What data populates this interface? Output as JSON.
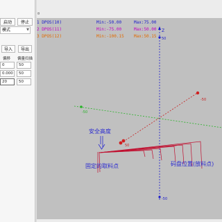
{
  "toolbar": {
    "button_1": "启动",
    "button_2": "停止",
    "mode_value": "模式",
    "import_label": "导入",
    "export_label": "导出",
    "tab_marker": "¤"
  },
  "table": {
    "headers": [
      "偏移",
      "偏量扫描"
    ],
    "rows": [
      [
        "0",
        "50"
      ],
      [
        "0.000",
        "50"
      ],
      [
        "20",
        "50"
      ]
    ]
  },
  "axes_readout": [
    {
      "label": "1 DPOS(10)",
      "min": "Min:-50.00",
      "max": "Max:75.00",
      "color": "#1a1acc"
    },
    {
      "label": "2 DPOS(11)",
      "min": "Min:-75.00",
      "max": "Max:50.00",
      "color": "#c000c0"
    },
    {
      "label": "3 DPOS(12)",
      "min": "Min:-100.15",
      "max": "Max:50.15",
      "color": "#e26a00"
    }
  ],
  "viewport_labels": {
    "z_axis": "Z",
    "z_top": "50",
    "z_bottom": "-50",
    "x_left": "-50",
    "y_right": "-50",
    "point_mid": "50"
  },
  "annotations": {
    "safe_height": "安全高度",
    "fixed_pick": "固定的取料点",
    "pallet_pos": "码盘位置(放料点)"
  },
  "colors": {
    "viewport_bg": "#c0c0c0",
    "annotation_blue": "#2a2ad0",
    "annotation_red": "#c01030",
    "axis_blue": "#1a1acc",
    "axis_green": "#27b327",
    "trajectory_red": "#c82020"
  }
}
